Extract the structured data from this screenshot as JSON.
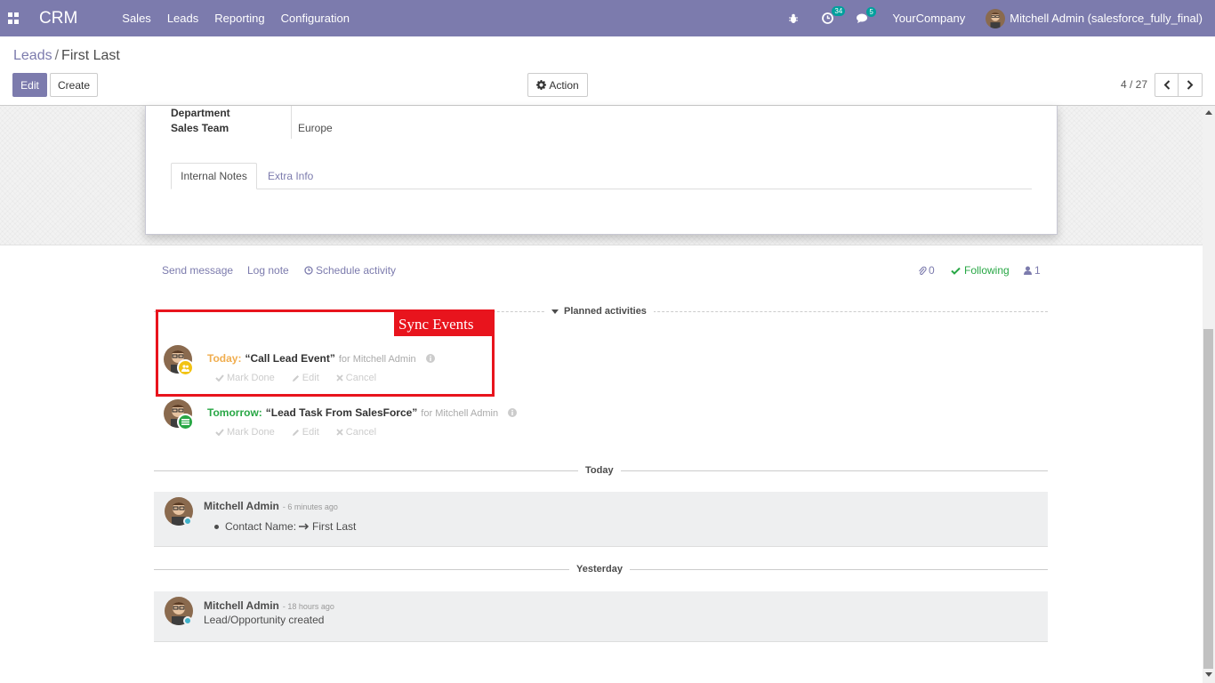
{
  "navbar": {
    "brand": "CRM",
    "menu": [
      "Sales",
      "Leads",
      "Reporting",
      "Configuration"
    ],
    "activity_count": "34",
    "message_count": "5",
    "company": "YourCompany",
    "user": "Mitchell Admin (salesforce_fully_final)"
  },
  "breadcrumb": {
    "parent": "Leads",
    "separator": "/",
    "current": "First Last"
  },
  "buttons": {
    "edit": "Edit",
    "create": "Create",
    "action": "Action"
  },
  "pager": {
    "value": "4 / 27"
  },
  "form": {
    "department_label": "Department",
    "department_value": "",
    "sales_team_label": "Sales Team",
    "sales_team_value": "Europe",
    "tabs": [
      "Internal Notes",
      "Extra Info"
    ]
  },
  "chatter": {
    "send_message": "Send message",
    "log_note": "Log note",
    "schedule_activity": "Schedule activity",
    "attachments": "0",
    "following": "Following",
    "followers": "1",
    "planned_title": "Planned activities",
    "activities": [
      {
        "when": "Today:",
        "title": "“Call Lead Event”",
        "for": "for Mitchell Admin",
        "when_color": "#f0ad4e",
        "badge_color": "#f2c313"
      },
      {
        "when": "Tomorrow:",
        "title": "“Lead Task From SalesForce”",
        "for": "for Mitchell Admin",
        "when_color": "#28a745",
        "badge_color": "#28a745"
      }
    ],
    "tools": {
      "mark_done": "Mark Done",
      "edit": "Edit",
      "cancel": "Cancel"
    },
    "today_title": "Today",
    "yesterday_title": "Yesterday",
    "messages": [
      {
        "author": "Mitchell Admin",
        "date": "- 6 minutes ago",
        "body_label": "Contact Name:",
        "body_value": "First Last"
      },
      {
        "author": "Mitchell Admin",
        "date": "- 18 hours ago",
        "body": "Lead/Opportunity created"
      }
    ]
  },
  "annotation": {
    "label": "Sync Events",
    "color": "#e8141d"
  },
  "colors": {
    "brand": "#7c7bad",
    "following": "#28a745"
  }
}
